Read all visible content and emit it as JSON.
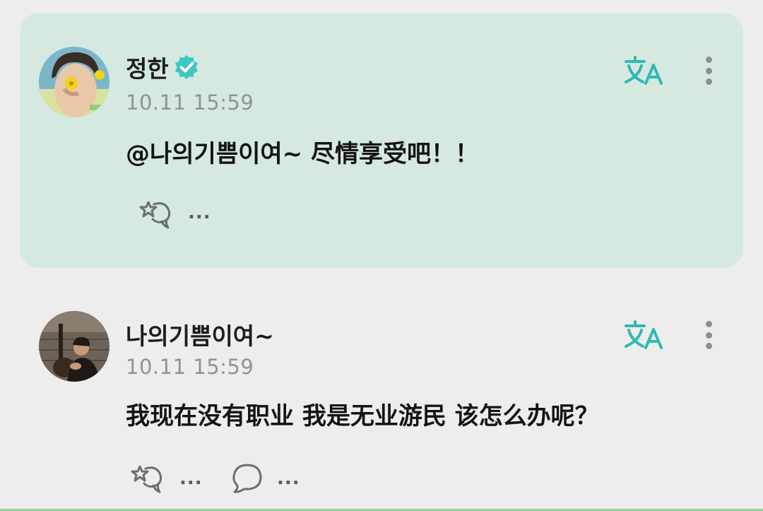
{
  "colors": {
    "card_bg": "#d5e9e1",
    "page_bg": "#ededed",
    "accent_teal": "#2fb9b1",
    "verified_badge": "#3ec6c0",
    "timestamp_gray": "#8d9590"
  },
  "comments": [
    {
      "username": "정한",
      "verified": true,
      "timestamp": "10.11 15:59",
      "content": "@나의기쁨이여~ 尽情享受吧！！",
      "highlighted": true,
      "icons": [
        "avatar-photo",
        "verified-icon",
        "translate-icon",
        "more-vertical-icon",
        "fan-letter-icon"
      ],
      "like_dots": "..."
    },
    {
      "username": "나의기쁨이여~",
      "verified": false,
      "timestamp": "10.11 15:59",
      "content": "我现在没有职业 我是无业游民 该怎么办呢？",
      "highlighted": false,
      "icons": [
        "avatar-photo",
        "translate-icon",
        "more-vertical-icon",
        "fan-letter-icon",
        "reply-bubble-icon"
      ],
      "like_dots": "...",
      "reply_dots": "..."
    }
  ]
}
